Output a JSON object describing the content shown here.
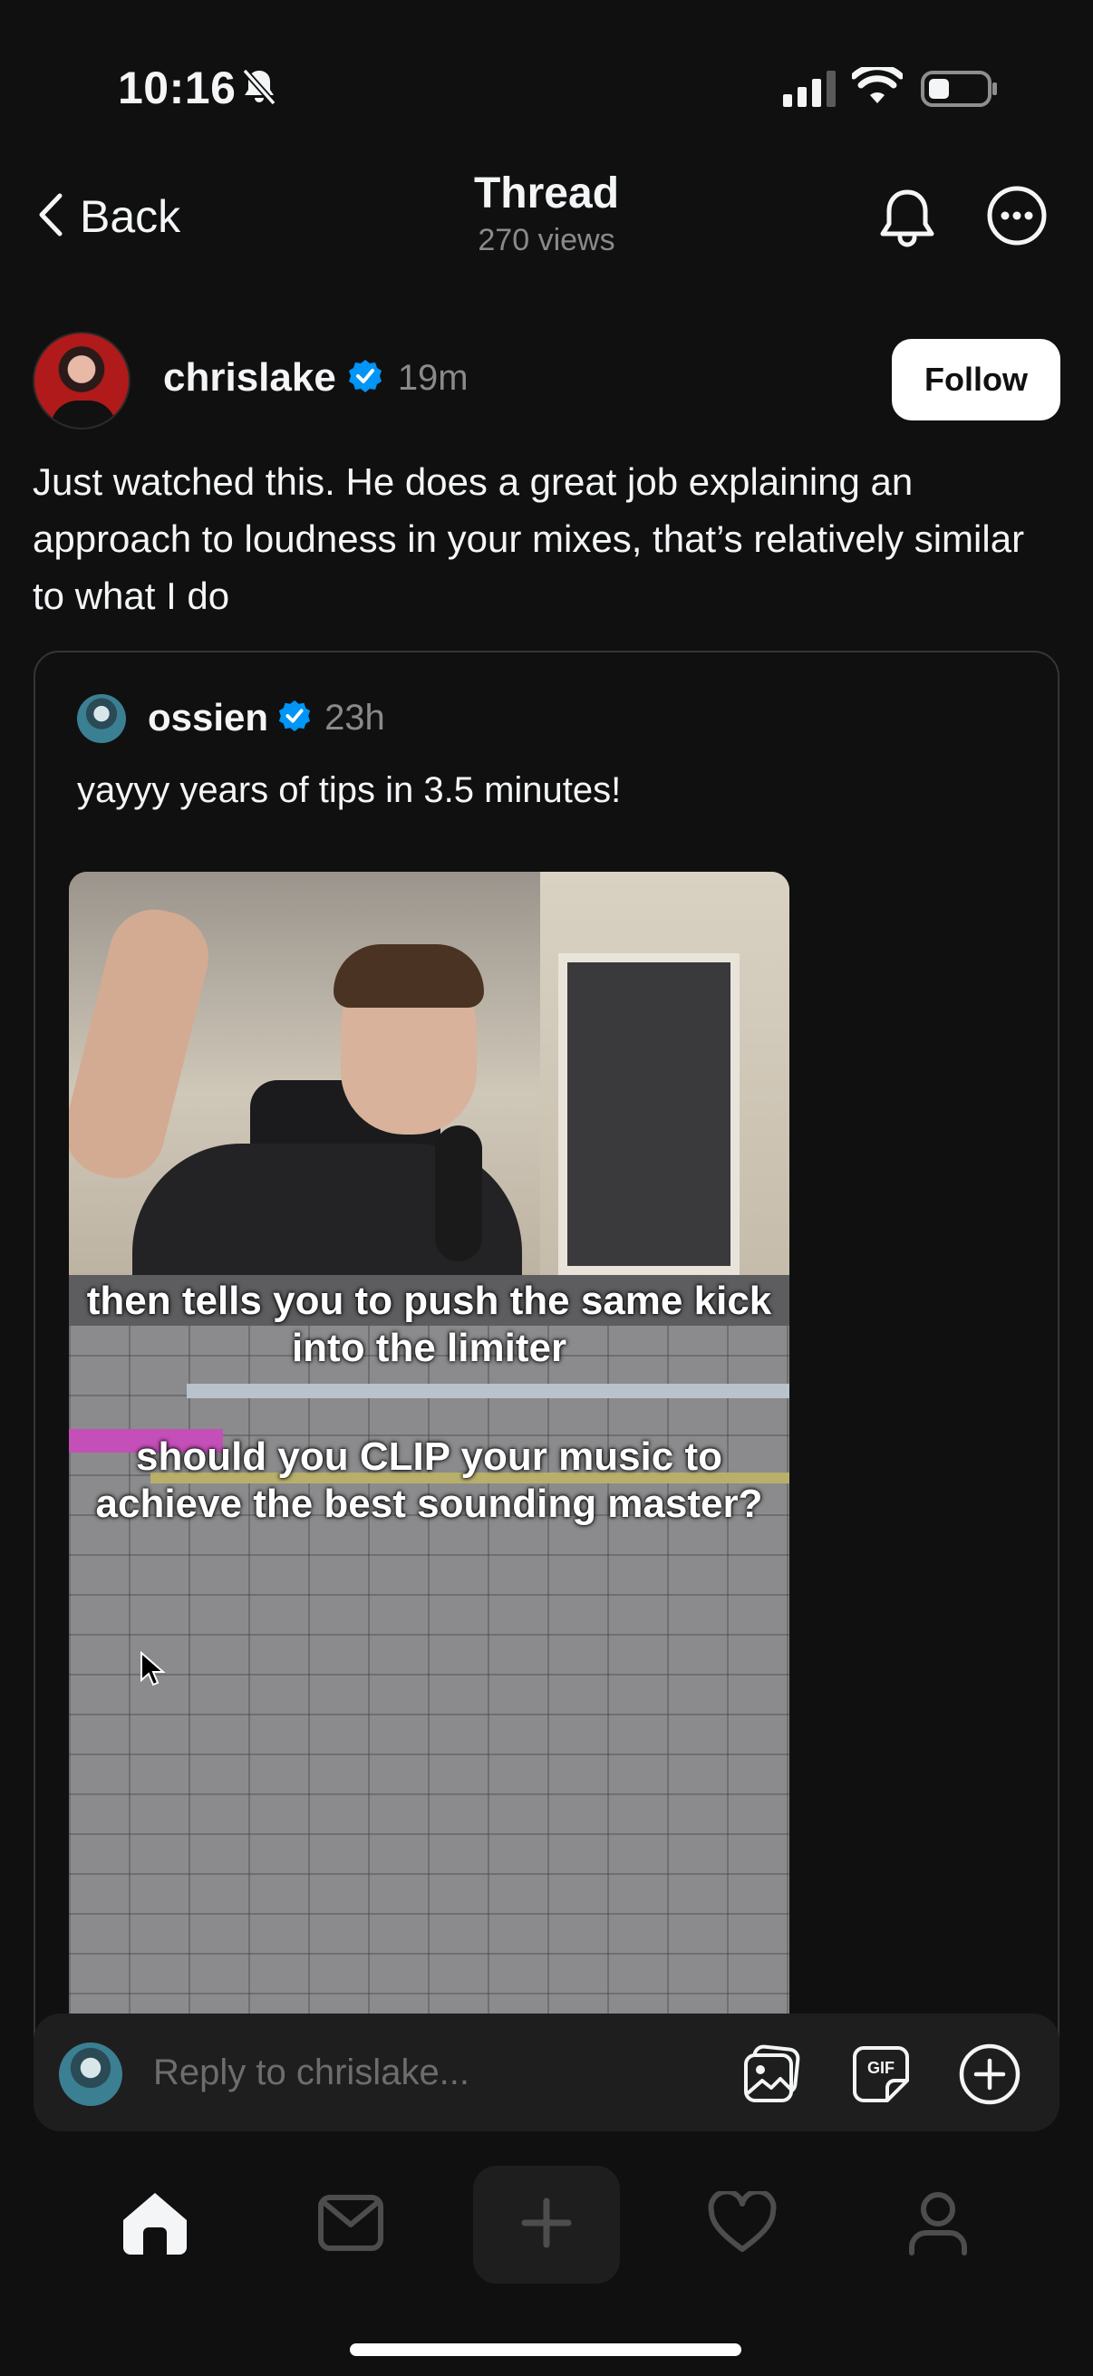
{
  "status_bar": {
    "time": "10:16",
    "icons": [
      "bell-slash-icon",
      "cellular-signal-icon",
      "wifi-icon",
      "battery-icon"
    ]
  },
  "header": {
    "back_label": "Back",
    "title": "Thread",
    "views": "270 views"
  },
  "post": {
    "username": "chrislake",
    "time": "19m",
    "follow_label": "Follow",
    "text": "Just watched this.  He does a great job explaining an approach to loudness in your mixes, that’s relatively similar to what I do"
  },
  "quoted_post": {
    "username": "ossien",
    "time": "23h",
    "text": "yayyy years of tips in 3.5 minutes!",
    "video": {
      "caption_1": "then tells you to push the same kick into the limiter",
      "caption_2": "should you CLIP your music to achieve the best sounding master?"
    }
  },
  "reply": {
    "placeholder": "Reply to chrislake..."
  },
  "tab_bar": {
    "tabs": [
      "home-icon",
      "inbox-icon",
      "create-icon",
      "activity-icon",
      "profile-icon"
    ]
  },
  "colors": {
    "background": "#101010",
    "verified": "#0095f6",
    "muted": "#8a8a8a"
  }
}
